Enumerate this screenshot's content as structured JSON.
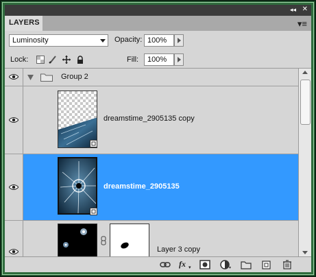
{
  "panel": {
    "tab_label": "LAYERS",
    "collapse_glyph": "◂◂",
    "close_glyph": "✕",
    "menu_glyph": "▾≡"
  },
  "blend": {
    "mode": "Luminosity"
  },
  "opacity": {
    "label": "Opacity:",
    "value": "100%"
  },
  "lock": {
    "label": "Lock:"
  },
  "fill": {
    "label": "Fill:",
    "value": "100%"
  },
  "layers": [
    {
      "name": "Group 2",
      "type": "group",
      "expanded": true
    },
    {
      "name": "dreamstime_2905135 copy",
      "type": "smart-object"
    },
    {
      "name": "dreamstime_2905135",
      "type": "smart-object",
      "selected": true
    },
    {
      "name": "Layer 3 copy",
      "type": "layer-with-mask"
    }
  ],
  "colors": {
    "selection": "#3399ff",
    "panel": "#d6d6d6",
    "frame": "#2f6b3d"
  },
  "bottom_icons": [
    "link-layers-icon",
    "fx-icon",
    "add-mask-icon",
    "adjustment-layer-icon",
    "new-group-icon",
    "new-layer-icon",
    "delete-icon"
  ],
  "bottom_labels": {
    "fx": "fx"
  }
}
